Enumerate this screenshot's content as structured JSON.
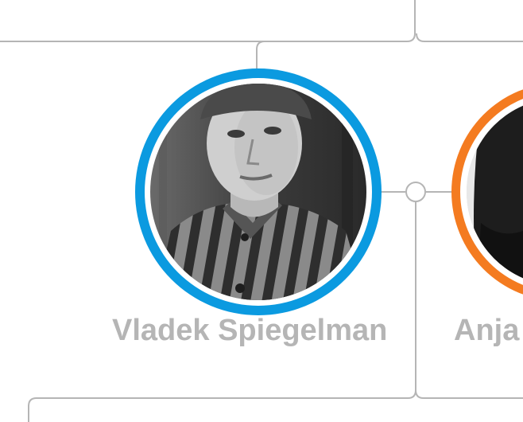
{
  "tree": {
    "people": [
      {
        "name": "Vladek Spiegelman",
        "ring_color": "#0b9ae0",
        "photo": "portrait-striped-uniform"
      },
      {
        "name": "Anja",
        "ring_color": "#f47b20",
        "photo": "portrait"
      }
    ],
    "connector_color": "#b5b5b5"
  }
}
